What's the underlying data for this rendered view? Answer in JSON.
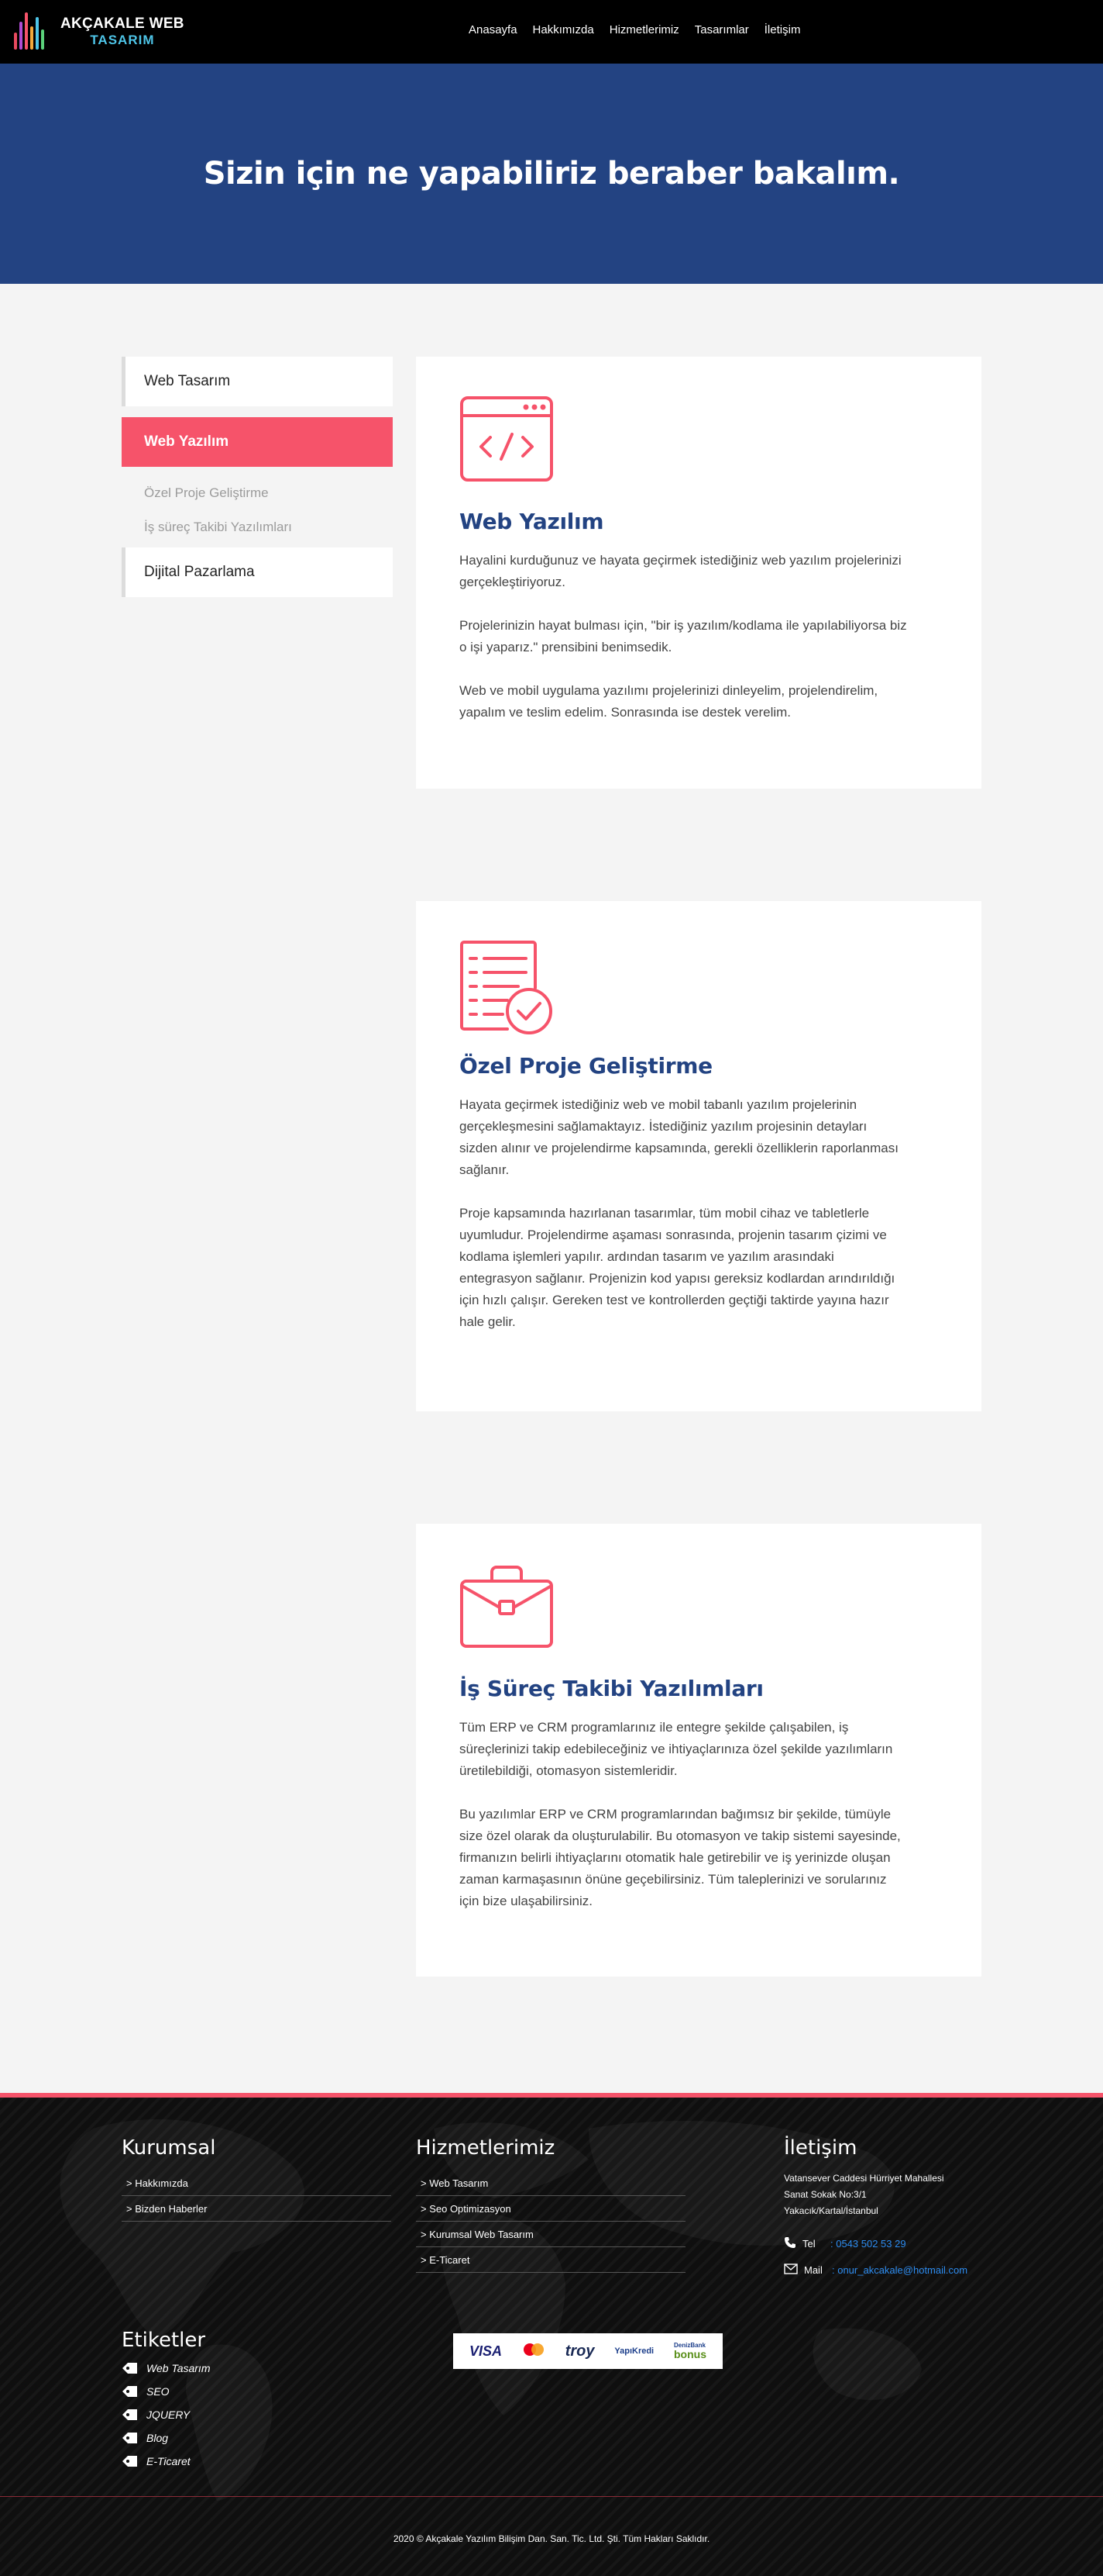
{
  "logo": {
    "line1": "AKÇAKALE WEB",
    "line2": "TASARIM"
  },
  "nav": [
    "Anasayfa",
    "Hakkımızda",
    "Hizmetlerimiz",
    "Tasarımlar",
    "İletişim"
  ],
  "hero": {
    "title": "Sizin için ne yapabiliriz beraber bakalım."
  },
  "sidebar": {
    "items": [
      "Web Tasarım",
      "Web Yazılım",
      "Dijital Pazarlama"
    ],
    "active": "Web Yazılım",
    "subitems": [
      "Özel Proje Geliştirme",
      "İş süreç Takibi Yazılımları"
    ]
  },
  "cards": [
    {
      "icon": "code-window-icon",
      "title": "Web Yazılım",
      "paragraphs": [
        "Hayalini kurduğunuz ve hayata geçirmek istediğiniz web yazılım projelerinizi gerçekleştiriyoruz.",
        "Projelerinizin hayat bulması için, \"bir iş yazılım/kodlama ile yapılabiliyorsa biz o işi yaparız.\" prensibini benimsedik.",
        "Web ve mobil uygulama yazılımı projelerinizi dinleyelim, projelendirelim, yapalım ve teslim edelim. Sonrasında ise destek verelim."
      ]
    },
    {
      "icon": "checklist-icon",
      "title": "Özel Proje Geliştirme",
      "paragraphs": [
        "Hayata geçirmek istediğiniz web ve mobil tabanlı yazılım projelerinin gerçekleşmesini sağlamaktayız. İstediğiniz yazılım projesinin detayları sizden alınır ve projelendirme kapsamında, gerekli özelliklerin raporlanması sağlanır.",
        "Proje kapsamında hazırlanan tasarımlar, tüm mobil cihaz ve tabletlerle uyumludur. Projelendirme aşaması sonrasında, projenin tasarım çizimi ve kodlama işlemleri yapılır. ardından tasarım ve yazılım arasındaki entegrasyon sağlanır. Projenizin kod yapısı gereksiz kodlardan arındırıldığı için hızlı çalışır. Gereken test ve kontrollerden geçtiği taktirde yayına hazır hale gelir."
      ]
    },
    {
      "icon": "briefcase-icon",
      "title": "İş Süreç Takibi Yazılımları",
      "paragraphs": [
        "Tüm ERP ve CRM programlarınız ile entegre şekilde çalışabilen, iş süreçlerinizi takip edebileceğiniz ve ihtiyaçlarınıza özel şekilde yazılımların üretilebildiği, otomasyon sistemleridir.",
        "Bu yazılımlar ERP ve CRM programlarından bağımsız bir şekilde, tümüyle size özel olarak da oluşturulabilir. Bu otomasyon ve takip sistemi sayesinde, firmanızın belirli ihtiyaçlarını otomatik hale getirebilir ve iş yerinizde oluşan zaman karmaşasının önüne geçebilirsiniz. Tüm taleplerinizi ve sorularınız için bize ulaşabilirsiniz."
      ]
    }
  ],
  "footer": {
    "kurumsal": {
      "title": "Kurumsal",
      "links": [
        "> Hakkımızda",
        "> Bizden Haberler"
      ]
    },
    "hizmetler": {
      "title": "Hizmetlerimiz",
      "links": [
        "> Web Tasarım",
        "> Seo Optimizasyon",
        "> Kurumsal Web Tasarım",
        "> E-Ticaret"
      ]
    },
    "iletisim": {
      "title": "İletişim",
      "address": [
        "Vatansever Caddesi Hürriyet Mahallesi",
        "Sanat Sokak No:3/1",
        "Yakacık/Kartal/İstanbul"
      ],
      "tel_label": "Tel",
      "tel": ": 0543 502 53 29",
      "mail_label": "Mail",
      "mail": ": onur_akcakale@hotmail.com"
    },
    "etiketler": {
      "title": "Etiketler",
      "tags": [
        "Web Tasarım",
        "SEO",
        "JQUERY",
        "Blog",
        "E-Ticaret"
      ]
    },
    "payment": {
      "visa": "VISA",
      "troy": "troy",
      "yapikredi": "YapıKredi",
      "bonus_small": "DenizBank",
      "bonus": "bonus"
    },
    "copyright": "2020 © Akçakale Yazılım Bilişim Dan. San. Tic. Ltd. Şti. Tüm Hakları Saklıdır."
  },
  "colors": {
    "accent": "#f6536a",
    "brand_blue": "#234382",
    "header_bg": "#000000",
    "footer_bg": "#0f0f0f",
    "link_blue": "#2d8cf0"
  }
}
